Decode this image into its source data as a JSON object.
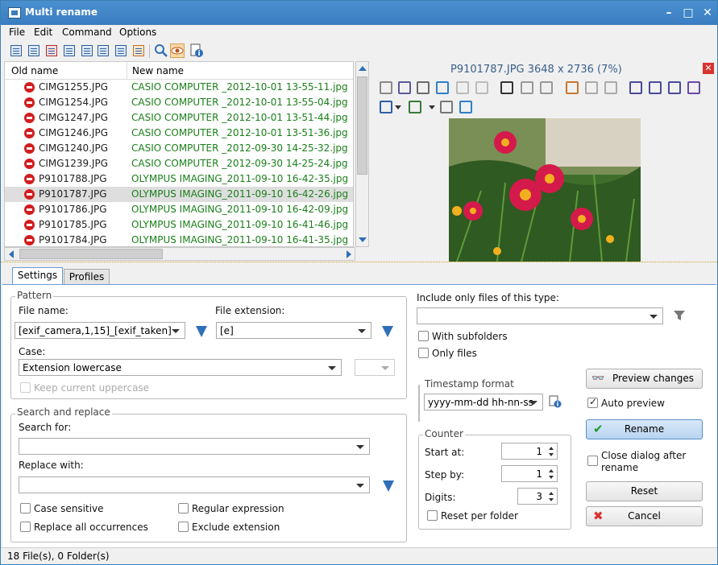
{
  "window": {
    "title": "Multi rename"
  },
  "menu": [
    "File",
    "Edit",
    "Command",
    "Options"
  ],
  "list": {
    "col_old": "Old name",
    "col_new": "New name",
    "rows": [
      {
        "old": "CIMG1255.JPG",
        "new": "CASIO COMPUTER _2012-10-01 13-55-11.jpg"
      },
      {
        "old": "CIMG1254.JPG",
        "new": "CASIO COMPUTER _2012-10-01 13-55-04.jpg"
      },
      {
        "old": "CIMG1247.JPG",
        "new": "CASIO COMPUTER _2012-10-01 13-51-44.jpg"
      },
      {
        "old": "CIMG1246.JPG",
        "new": "CASIO COMPUTER _2012-10-01 13-51-36.jpg"
      },
      {
        "old": "CIMG1240.JPG",
        "new": "CASIO COMPUTER _2012-09-30 14-25-32.jpg"
      },
      {
        "old": "CIMG1239.JPG",
        "new": "CASIO COMPUTER _2012-09-30 14-25-24.jpg"
      },
      {
        "old": "P9101788.JPG",
        "new": "OLYMPUS IMAGING_2011-09-10 16-42-35.jpg"
      },
      {
        "old": "P9101787.JPG",
        "new": "OLYMPUS IMAGING_2011-09-10 16-42-26.jpg",
        "selected": true
      },
      {
        "old": "P9101786.JPG",
        "new": "OLYMPUS IMAGING_2011-09-10 16-42-09.jpg"
      },
      {
        "old": "P9101785.JPG",
        "new": "OLYMPUS IMAGING_2011-09-10 16-41-46.jpg"
      },
      {
        "old": "P9101784.JPG",
        "new": "OLYMPUS IMAGING_2011-09-10 16-41-35.jpg"
      }
    ]
  },
  "preview": {
    "title": "P9101787.JPG   3648 x 2736 (7%)",
    "close": "✕"
  },
  "tabs": {
    "settings": "Settings",
    "profiles": "Profiles"
  },
  "pattern": {
    "group": "Pattern",
    "file_name_label": "File name:",
    "file_name_value": "[exif_camera,1,15]_[exif_taken]",
    "file_ext_label": "File extension:",
    "file_ext_value": "[e]",
    "case_label": "Case:",
    "case_value": "Extension lowercase",
    "keep_upper": "Keep current uppercase"
  },
  "search": {
    "group": "Search and replace",
    "search_label": "Search for:",
    "replace_label": "Replace with:",
    "case_sensitive": "Case sensitive",
    "regex": "Regular expression",
    "replace_all": "Replace all occurrences",
    "exclude_ext": "Exclude extension"
  },
  "filter": {
    "include_label": "Include only files of this type:",
    "with_subfolders": "With subfolders",
    "only_files": "Only files"
  },
  "timestamp": {
    "group": "Timestamp format",
    "value": "yyyy-mm-dd hh-nn-ss"
  },
  "counter": {
    "group": "Counter",
    "start_label": "Start at:",
    "start_value": "1",
    "step_label": "Step by:",
    "step_value": "1",
    "digits_label": "Digits:",
    "digits_value": "3",
    "reset_per_folder": "Reset per folder"
  },
  "actions": {
    "preview_changes": "Preview changes",
    "auto_preview": "Auto preview",
    "rename": "Rename",
    "close_after": "Close dialog after rename",
    "reset": "Reset",
    "cancel": "Cancel"
  },
  "status": "18 File(s), 0 Folder(s)"
}
